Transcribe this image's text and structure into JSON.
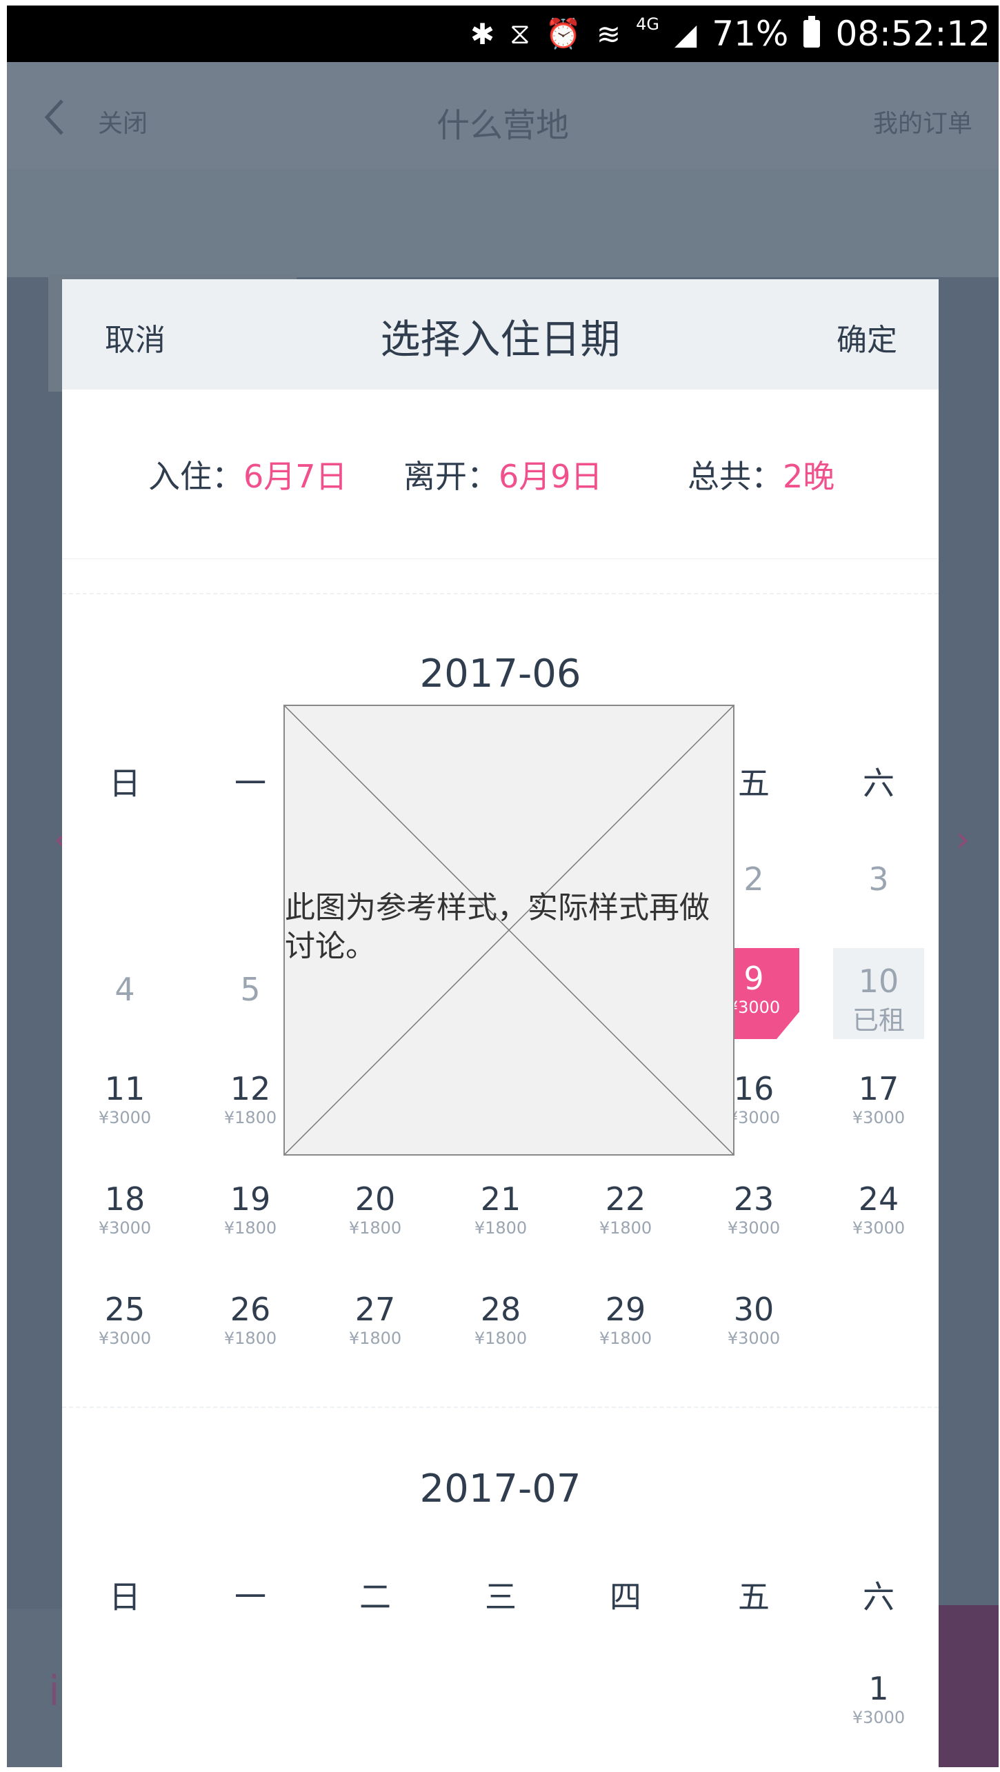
{
  "status_bar": {
    "icons": [
      "bluetooth-icon",
      "vibrate-icon",
      "alarm-icon",
      "wifi-icon",
      "signal-icon"
    ],
    "network": "4G",
    "battery": "71%",
    "time": "08:52:12"
  },
  "nav": {
    "close_label": "关闭",
    "title": "什么营地",
    "orders_label": "我的订单"
  },
  "dialog": {
    "cancel_label": "取消",
    "title": "选择入住日期",
    "confirm_label": "确定",
    "summary": {
      "checkin_label": "入住：",
      "checkin_value": "6月7日",
      "checkout_label": "离开：",
      "checkout_value": "6月9日",
      "total_label": "总共：",
      "total_value": "2晚"
    }
  },
  "calendar": {
    "weekdays": [
      "日",
      "一",
      "二",
      "三",
      "四",
      "五",
      "六"
    ],
    "month1": {
      "title": "2017-06",
      "days": [
        {
          "num": "2",
          "price": ""
        },
        {
          "num": "3",
          "price": ""
        },
        {
          "num": "4",
          "price": ""
        },
        {
          "num": "5",
          "price": ""
        },
        {
          "num": "9",
          "price": "¥3000"
        },
        {
          "num": "10",
          "price": "已租"
        },
        {
          "num": "11",
          "price": "¥3000"
        },
        {
          "num": "12",
          "price": "¥1800"
        },
        {
          "num": "16",
          "price": "¥3000"
        },
        {
          "num": "17",
          "price": "¥3000"
        },
        {
          "num": "18",
          "price": "¥3000"
        },
        {
          "num": "19",
          "price": "¥1800"
        },
        {
          "num": "20",
          "price": "¥1800"
        },
        {
          "num": "21",
          "price": "¥1800"
        },
        {
          "num": "22",
          "price": "¥1800"
        },
        {
          "num": "23",
          "price": "¥3000"
        },
        {
          "num": "24",
          "price": "¥3000"
        },
        {
          "num": "25",
          "price": "¥3000"
        },
        {
          "num": "26",
          "price": "¥1800"
        },
        {
          "num": "27",
          "price": "¥1800"
        },
        {
          "num": "28",
          "price": "¥1800"
        },
        {
          "num": "29",
          "price": "¥1800"
        },
        {
          "num": "30",
          "price": "¥3000"
        }
      ]
    },
    "month2": {
      "title": "2017-07",
      "days": [
        {
          "num": "1",
          "price": "¥3000"
        }
      ]
    }
  },
  "placeholder": {
    "text": "此图为参考样式，实际样式再做讨论。"
  },
  "colors": {
    "accent": "#f0508c",
    "text": "#2f3d4e",
    "muted": "#9aa5b1",
    "overlay": "#596778"
  }
}
